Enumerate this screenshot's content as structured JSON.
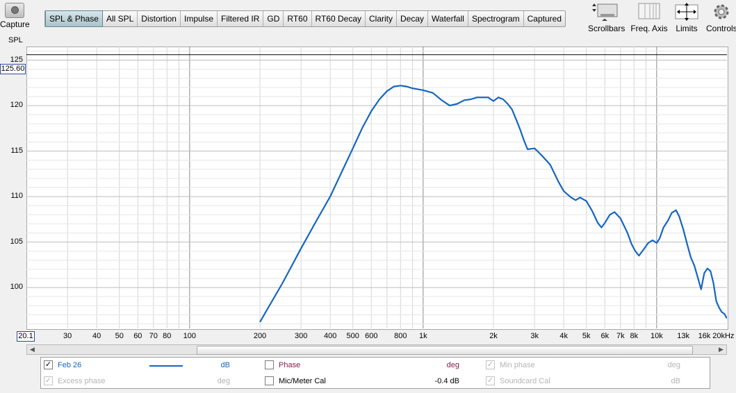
{
  "toolbar": {
    "capture_label": "Capture",
    "spl_label": "SPL",
    "tabs": [
      "SPL & Phase",
      "All SPL",
      "Distortion",
      "Impulse",
      "Filtered IR",
      "GD",
      "RT60",
      "RT60 Decay",
      "Clarity",
      "Decay",
      "Waterfall",
      "Spectrogram",
      "Captured"
    ],
    "active_tab": "SPL & Phase",
    "scrollbars_label": "Scrollbars",
    "freq_axis_label": "Freq. Axis",
    "limits_label": "Limits",
    "controls_label": "Controls"
  },
  "chart_data": {
    "type": "line",
    "x_scale": "log",
    "xlim": [
      20,
      20000
    ],
    "ylim": [
      95.5,
      126.5
    ],
    "y_ticks": [
      "125",
      "120",
      "115",
      "110",
      "105",
      "100"
    ],
    "x_ticks": [
      "30",
      "40",
      "50",
      "60",
      "70",
      "80",
      "100",
      "200",
      "300",
      "400",
      "500",
      "600",
      "800",
      "1k",
      "2k",
      "3k",
      "4k",
      "5k",
      "6k",
      "7k",
      "8k",
      "10k",
      "13k",
      "16k",
      "20kHz"
    ],
    "cursor_y_value": "125.60",
    "y_axis_min_label": "20.1",
    "series": [
      {
        "name": "Feb 26",
        "color": "#1565c0",
        "points": [
          [
            200,
            96.2
          ],
          [
            250,
            100.5
          ],
          [
            300,
            104.3
          ],
          [
            350,
            107.4
          ],
          [
            400,
            110.0
          ],
          [
            450,
            112.8
          ],
          [
            500,
            115.3
          ],
          [
            550,
            117.6
          ],
          [
            600,
            119.4
          ],
          [
            650,
            120.7
          ],
          [
            700,
            121.6
          ],
          [
            750,
            122.1
          ],
          [
            800,
            122.2
          ],
          [
            850,
            122.1
          ],
          [
            900,
            121.9
          ],
          [
            1000,
            121.7
          ],
          [
            1100,
            121.4
          ],
          [
            1200,
            120.6
          ],
          [
            1300,
            120.0
          ],
          [
            1400,
            120.2
          ],
          [
            1500,
            120.6
          ],
          [
            1600,
            120.7
          ],
          [
            1700,
            120.9
          ],
          [
            1900,
            120.9
          ],
          [
            2000,
            120.5
          ],
          [
            2100,
            120.9
          ],
          [
            2200,
            120.7
          ],
          [
            2300,
            120.2
          ],
          [
            2400,
            119.6
          ],
          [
            2500,
            118.5
          ],
          [
            2600,
            117.4
          ],
          [
            2700,
            116.2
          ],
          [
            2800,
            115.2
          ],
          [
            3000,
            115.3
          ],
          [
            3200,
            114.6
          ],
          [
            3500,
            113.5
          ],
          [
            3800,
            111.6
          ],
          [
            4000,
            110.6
          ],
          [
            4300,
            109.9
          ],
          [
            4500,
            109.6
          ],
          [
            4700,
            109.9
          ],
          [
            5000,
            109.5
          ],
          [
            5300,
            108.4
          ],
          [
            5600,
            107.1
          ],
          [
            5800,
            106.6
          ],
          [
            6000,
            107.1
          ],
          [
            6300,
            108.0
          ],
          [
            6600,
            108.3
          ],
          [
            7000,
            107.6
          ],
          [
            7500,
            106.0
          ],
          [
            7800,
            104.8
          ],
          [
            8100,
            104.0
          ],
          [
            8400,
            103.5
          ],
          [
            8800,
            104.2
          ],
          [
            9200,
            104.9
          ],
          [
            9600,
            105.2
          ],
          [
            10000,
            104.9
          ],
          [
            10300,
            105.4
          ],
          [
            10700,
            106.6
          ],
          [
            11200,
            107.4
          ],
          [
            11600,
            108.2
          ],
          [
            12100,
            108.5
          ],
          [
            12500,
            107.8
          ],
          [
            13000,
            106.4
          ],
          [
            13500,
            104.8
          ],
          [
            14000,
            103.3
          ],
          [
            14500,
            102.4
          ],
          [
            15000,
            101.1
          ],
          [
            15500,
            99.8
          ],
          [
            16000,
            101.6
          ],
          [
            16500,
            102.1
          ],
          [
            17000,
            101.8
          ],
          [
            17500,
            100.5
          ],
          [
            18000,
            98.5
          ],
          [
            18500,
            97.8
          ],
          [
            19000,
            97.3
          ],
          [
            19500,
            97.1
          ],
          [
            20000,
            96.6
          ]
        ]
      }
    ]
  },
  "legend": {
    "row1": [
      {
        "label": "Feb 26",
        "checked": true,
        "unit": "dB",
        "enabled": true,
        "color": "#1565c0"
      },
      {
        "label": "Phase",
        "checked": false,
        "unit": "deg",
        "enabled": true,
        "color": "#8b1a4a"
      },
      {
        "label": "Min phase",
        "checked": true,
        "unit": "deg",
        "enabled": false,
        "color": "#b4b4b4"
      }
    ],
    "row2": [
      {
        "label": "Excess phase",
        "checked": true,
        "unit": "deg",
        "enabled": false,
        "color": "#b4b4b4"
      },
      {
        "label": "Mic/Meter Cal",
        "checked": false,
        "unit": "-0.4 dB",
        "enabled": true,
        "color": "#000000"
      },
      {
        "label": "Soundcard Cal",
        "checked": true,
        "unit": "dB",
        "enabled": false,
        "color": "#b4b4b4"
      }
    ]
  }
}
